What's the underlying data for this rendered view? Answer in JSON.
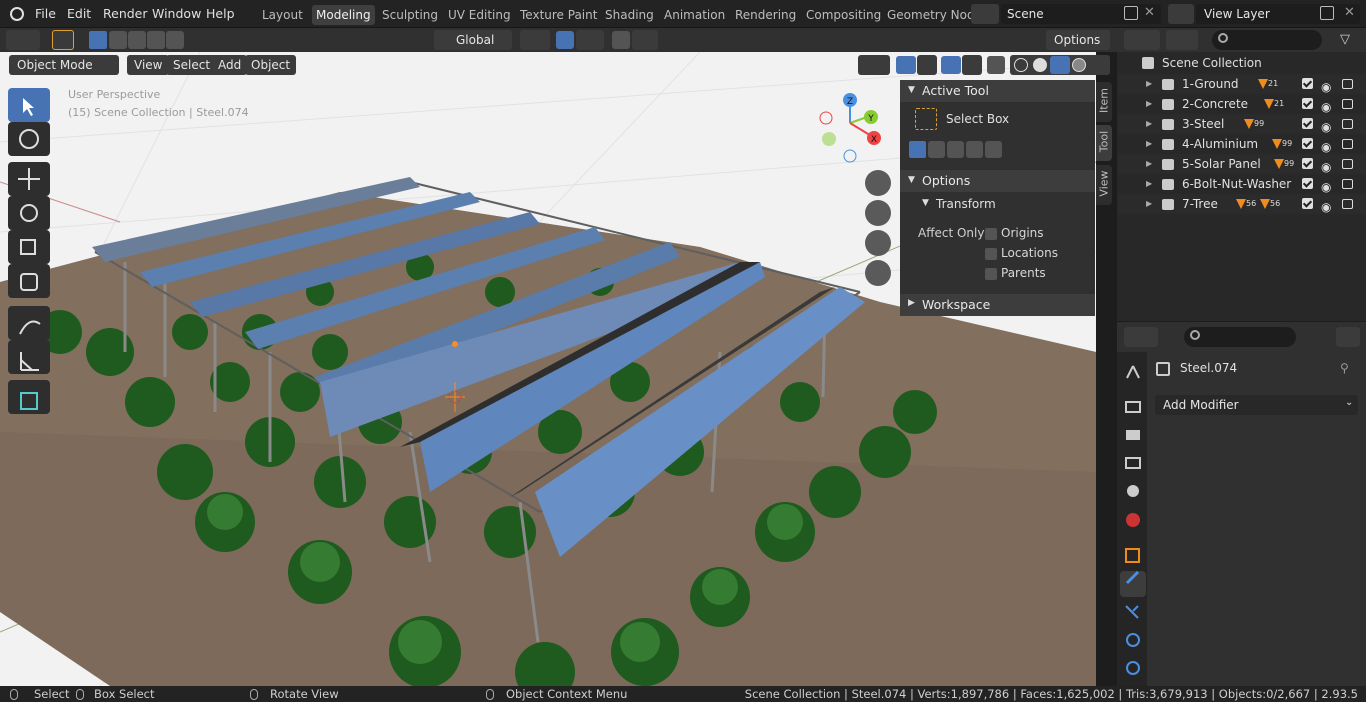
{
  "menu": {
    "file": "File",
    "edit": "Edit",
    "render": "Render",
    "window": "Window",
    "help": "Help"
  },
  "workspaces": [
    "Layout",
    "Modeling",
    "Sculpting",
    "UV Editing",
    "Texture Paint",
    "Shading",
    "Animation",
    "Rendering",
    "Compositing",
    "Geometry Nod"
  ],
  "scene": {
    "name": "Scene",
    "view_layer": "View Layer"
  },
  "viewport": {
    "mode": "Object Mode",
    "view": "View",
    "select": "Select",
    "add": "Add",
    "object": "Object",
    "orientation": "Global",
    "options": "Options",
    "overlay_line1": "User Perspective",
    "overlay_line2": "(15) Scene Collection | Steel.074"
  },
  "gizmo": {
    "z": "Z",
    "y": "Y",
    "x": "X"
  },
  "npanel": {
    "tabs": [
      "Item",
      "Tool",
      "View"
    ],
    "active_tool": "Active Tool",
    "tool_name": "Select Box",
    "options": "Options",
    "transform": "Transform",
    "affect_only": "Affect Only",
    "origins": "Origins",
    "locations": "Locations",
    "parents": "Parents",
    "workspace": "Workspace"
  },
  "outliner": {
    "root": "Scene Collection",
    "items": [
      {
        "label": "1-Ground",
        "count": "21"
      },
      {
        "label": "2-Concrete",
        "count": "21"
      },
      {
        "label": "3-Steel",
        "count": "99"
      },
      {
        "label": "4-Aluminium",
        "count": "99"
      },
      {
        "label": "5-Solar Panel",
        "count": "99"
      },
      {
        "label": "6-Bolt-Nut-Washer",
        "count": ""
      },
      {
        "label": "7-Tree",
        "count": "56",
        "count2": "56"
      }
    ]
  },
  "properties": {
    "object_name": "Steel.074",
    "add_modifier": "Add Modifier"
  },
  "status": {
    "select": "Select",
    "box_select": "Box Select",
    "rotate_view": "Rotate View",
    "context_menu": "Object Context Menu",
    "stats": "Scene Collection | Steel.074 | Verts:1,897,786 | Faces:1,625,002 | Tris:3,679,913 | Objects:0/2,667 | 2.93.5"
  },
  "colors": {
    "accent": "#4772b3",
    "ground": "#7d6a5a",
    "tree": "#2f6b2a",
    "panel": "#5b7fae"
  }
}
